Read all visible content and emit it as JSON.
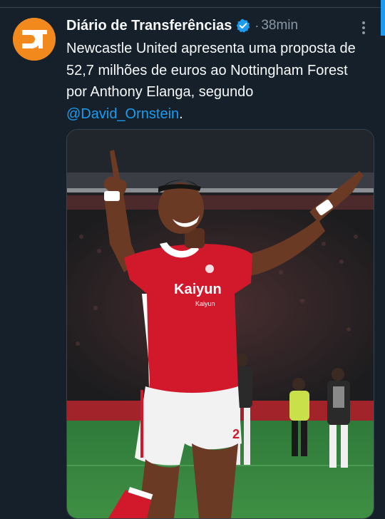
{
  "tweet": {
    "author_name": "Diário de Transferências",
    "separator": "·",
    "timestamp": "38min",
    "avatar_initials": "DT",
    "text_before_mention": "Newcastle United apresenta uma proposta de 52,7 milhões de euros ao Nottingham Forest por Anthony Elanga, segundo ",
    "mention": "@David_Ornstein",
    "text_after_mention": ".",
    "media": {
      "sponsor_text": "Kaiyun",
      "sponsor_sub": "Kaiyun"
    }
  },
  "colors": {
    "background": "#15202b",
    "text": "#f7f9f9",
    "secondary": "#8b98a5",
    "link": "#1d9bf0",
    "avatar_bg": "#f2891d",
    "verified": "#1d9bf0",
    "kit_red": "#d2192b"
  },
  "icons": {
    "verified": "verified-badge-icon",
    "more": "more-dots-icon"
  }
}
